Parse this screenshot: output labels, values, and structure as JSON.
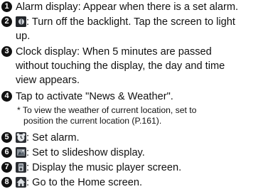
{
  "items": [
    {
      "num": "1",
      "text": "Alarm display: Appear when there is a set alarm."
    },
    {
      "num": "2",
      "icon": "backlight-off-icon",
      "text": ": Turn off the backlight. Tap the screen to light",
      "cont": "up."
    },
    {
      "num": "3",
      "text": "Clock display: When 5 minutes are passed",
      "cont1": "without touching the display, the day and time",
      "cont2": "view appears."
    },
    {
      "num": "4",
      "text": "Tap to activate \"News & Weather\".",
      "note1": "* To view the weather of current location, set to",
      "note2": "position the current location (P.161)."
    },
    {
      "num": "5",
      "icon": "alarm-clock-icon",
      "text": ": Set alarm."
    },
    {
      "num": "6",
      "icon": "slideshow-icon",
      "text": ": Set to slideshow display."
    },
    {
      "num": "7",
      "icon": "music-player-icon",
      "text": ": Display the music player screen."
    },
    {
      "num": "8",
      "icon": "home-icon",
      "text": ": Go to the Home screen."
    }
  ]
}
